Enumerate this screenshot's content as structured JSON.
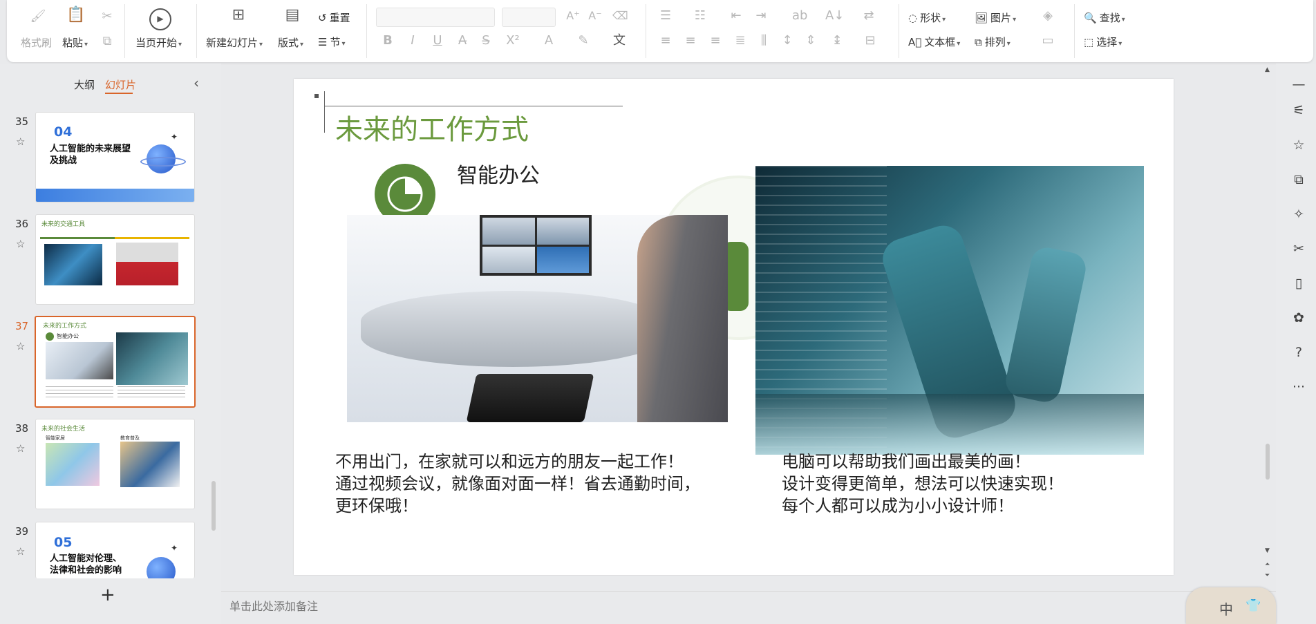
{
  "ribbon": {
    "clipboard": {
      "format_painter": "格式刷",
      "paste": "粘贴"
    },
    "slideshow": {
      "from_current": "当页开始"
    },
    "slides": {
      "new_slide": "新建幻灯片",
      "layout": "版式",
      "reset": "重置",
      "section": "节"
    },
    "drawing": {
      "shape": "形状",
      "picture": "图片",
      "textbox": "文本框",
      "arrange": "排列"
    },
    "editing": {
      "find": "查找",
      "select": "选择"
    }
  },
  "panel": {
    "tabs": [
      "大纲",
      "幻灯片"
    ],
    "active_tab": "幻灯片",
    "add_label": "+"
  },
  "slides": [
    {
      "number": "35",
      "badge": "04",
      "title": "人工智能的未来展望\n及挑战"
    },
    {
      "number": "36",
      "title": "未来的交通工具"
    },
    {
      "number": "37",
      "title": "未来的工作方式",
      "subtitle": "智能办公",
      "selected": true
    },
    {
      "number": "38",
      "title": "未来的社会生活",
      "label_a": "智能家居",
      "label_b": "教育普及"
    },
    {
      "number": "39",
      "badge": "05",
      "title": "人工智能对伦理、\n法律和社会的影响"
    }
  ],
  "slide": {
    "title": "未来的工作方式",
    "subtitle": "智能办公",
    "left_text": [
      "不用出门，在家就可以和远方的朋友一起工作！",
      "通过视频会议，就像面对面一样！省去通勤时间，",
      "更环保哦！"
    ],
    "right_text": [
      "电脑可以帮助我们画出最美的画！",
      "设计变得更简单，想法可以快速实现！",
      "每个人都可以成为小小设计师！"
    ]
  },
  "notes": {
    "placeholder": "单击此处添加备注"
  },
  "ime": {
    "label": "中"
  },
  "colors": {
    "accent": "#d9652a",
    "slide_green": "#5a8a3a",
    "title_green": "#6b9a3e"
  }
}
